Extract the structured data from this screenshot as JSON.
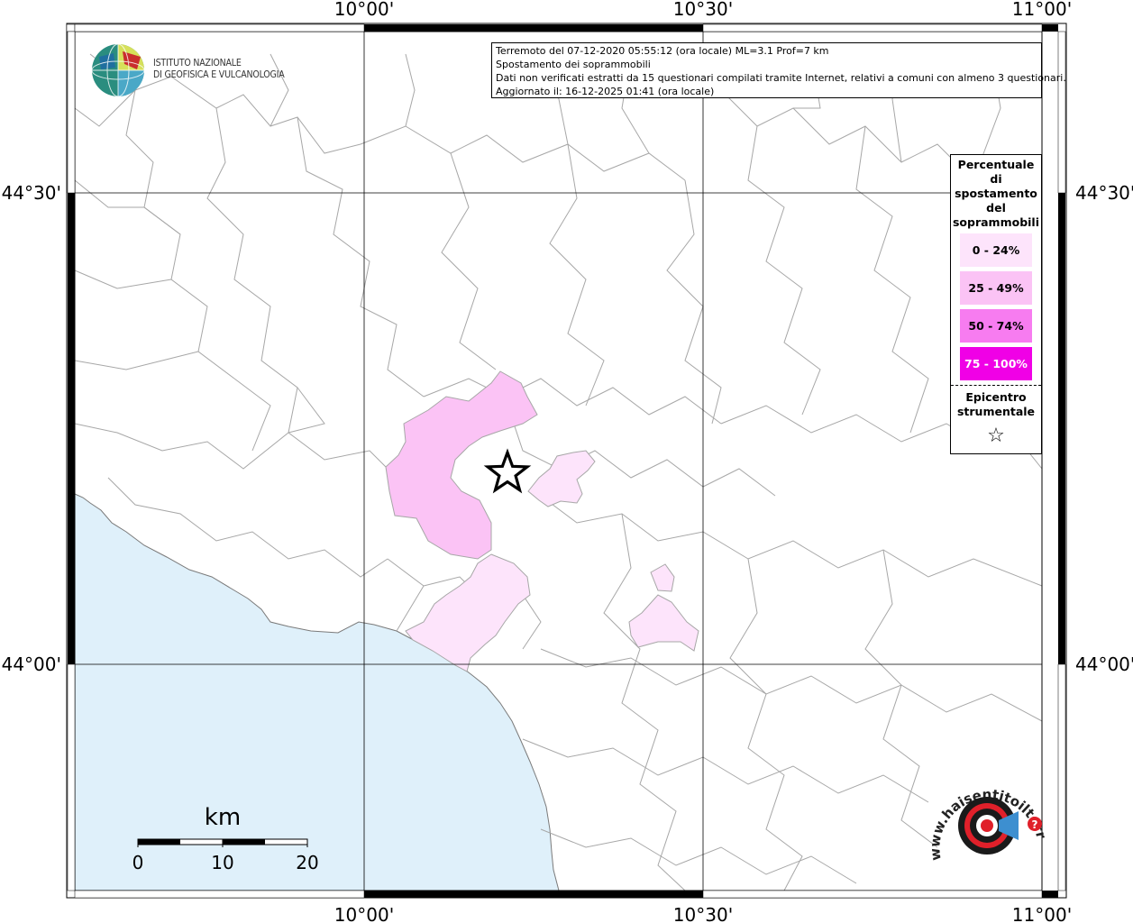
{
  "colors": {
    "sea": "#dff0fa",
    "boundary": "#a7a7a7",
    "class_0_24": "#fde4fb",
    "class_25_49": "#fbc3f5",
    "class_50_74": "#f77cf0",
    "class_75_100": "#f000e6"
  },
  "axis": {
    "top_labels": [
      "10°00'",
      "10°30'",
      "11°00'"
    ],
    "bottom_labels": [
      "10°00'",
      "10°30'",
      "11°00'"
    ],
    "left_labels": [
      "44°30'",
      "44°00'"
    ],
    "right_labels": [
      "44°30'",
      "44°00'"
    ]
  },
  "logo": {
    "icon": "ingv-globe-icon",
    "line1": "ISTITUTO NAZIONALE",
    "line2": "DI GEOFISICA E VULCANOLOGIA"
  },
  "info": {
    "line1": "Terremoto del 07-12-2020 05:55:12 (ora locale) ML=3.1 Prof=7 km",
    "line2": "Spostamento dei soprammobili",
    "line3": "Dati non verificati estratti da 15 questionari compilati tramite Internet, relativi a comuni con almeno 3 questionari.",
    "line4": "Aggiornato il: 16-12-2025 01:41 (ora locale)"
  },
  "legend": {
    "title_lines": [
      "Percentuale",
      "di",
      "spostamento",
      "del",
      "soprammobili"
    ],
    "items": [
      {
        "label": "0 - 24%",
        "color": "#fde4fb",
        "text_color": "#000000"
      },
      {
        "label": "25 - 49%",
        "color": "#fbc3f5",
        "text_color": "#000000"
      },
      {
        "label": "50 - 74%",
        "color": "#f77cf0",
        "text_color": "#000000"
      },
      {
        "label": "75 - 100%",
        "color": "#f000e6",
        "text_color": "#ffffff"
      }
    ],
    "epicenter_lines": [
      "Epicentro",
      "strumentale"
    ],
    "epicenter_symbol": "☆"
  },
  "scale_bar": {
    "unit": "km",
    "labels": [
      "0",
      "10",
      "20"
    ]
  },
  "hst_logo": {
    "text": "www.haisentitoilterremoto.it",
    "icon": "target-megaphone-icon"
  }
}
